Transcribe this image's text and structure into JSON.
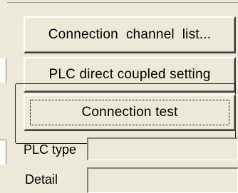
{
  "buttons": {
    "connection_channel_list": "Connection  channel  list...",
    "plc_direct_coupled_setting": "PLC direct coupled setting",
    "connection_test": "Connection test"
  },
  "fields": {
    "plc_type": {
      "label": "PLC type",
      "value": ""
    },
    "detail": {
      "label": "Detail",
      "value": ""
    }
  }
}
